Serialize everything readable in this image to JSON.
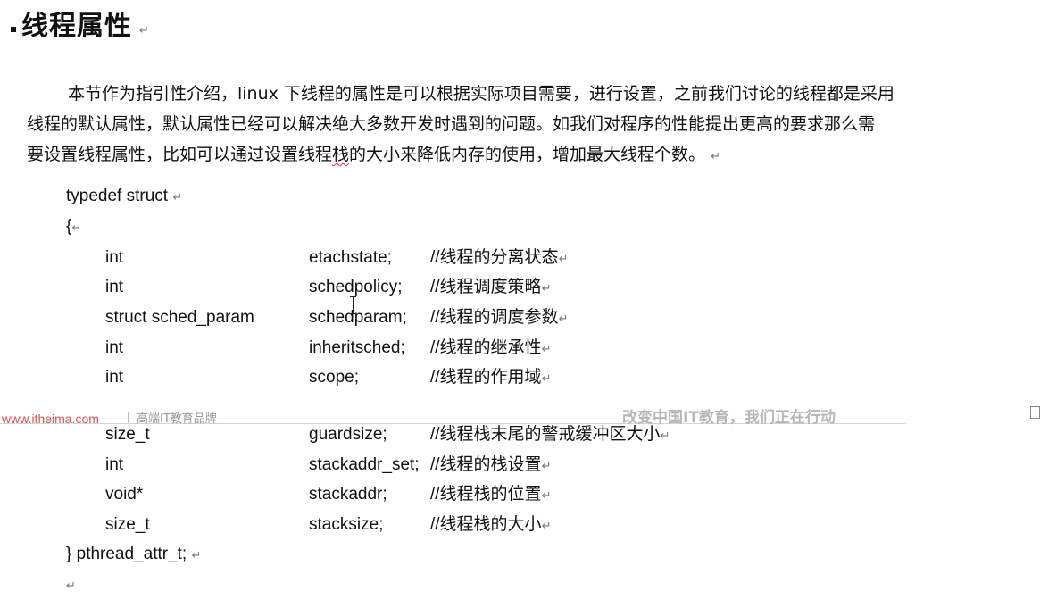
{
  "heading": "线程属性",
  "para_mark": "↵",
  "paragraph": {
    "line1": "本节作为指引性介绍，linux 下线程的属性是可以根据实际项目需要，进行设置，之前我们讨论的线程都是采用",
    "line2": "线程的默认属性，默认属性已经可以解决绝大多数开发时遇到的问题。如我们对程序的性能提出更高的要求那么需",
    "line3_before": "要设置线程属性，比如可以通过设置线程",
    "line3_mark": "栈",
    "line3_after": "的大小来降低内存的使用，增加最大线程个数。"
  },
  "code": {
    "open": "typedef struct",
    "brace_open": "{",
    "fields": [
      {
        "type": "int",
        "name": "etachstate;",
        "comment": "//线程的分离状态"
      },
      {
        "type": "int",
        "name": "schedpolicy;",
        "comment": "//线程调度策略"
      },
      {
        "type": "struct sched_param",
        "name": "schedparam;",
        "comment": "//线程的调度参数"
      },
      {
        "type": "int",
        "name": "inheritsched;",
        "comment": "//线程的继承性"
      },
      {
        "type": "int",
        "name": "scope;",
        "comment": "//线程的作用域"
      },
      {
        "type": "size_t",
        "name": "guardsize;",
        "comment": "//线程栈末尾的警戒缓冲区大小"
      },
      {
        "type": "int",
        "name": "stackaddr_set;",
        "comment": "//线程的栈设置"
      },
      {
        "type": "void*",
        "name": "stackaddr;",
        "comment": "//线程栈的位置"
      },
      {
        "type": "size_t",
        "name": "stacksize;",
        "comment": "//线程栈的大小"
      }
    ],
    "close": "} pthread_attr_t;"
  },
  "banner": {
    "site": "www.itheima.com",
    "brand": "高端IT教育品牌",
    "slogan": "改变中国IT教育，我们正在行动"
  }
}
